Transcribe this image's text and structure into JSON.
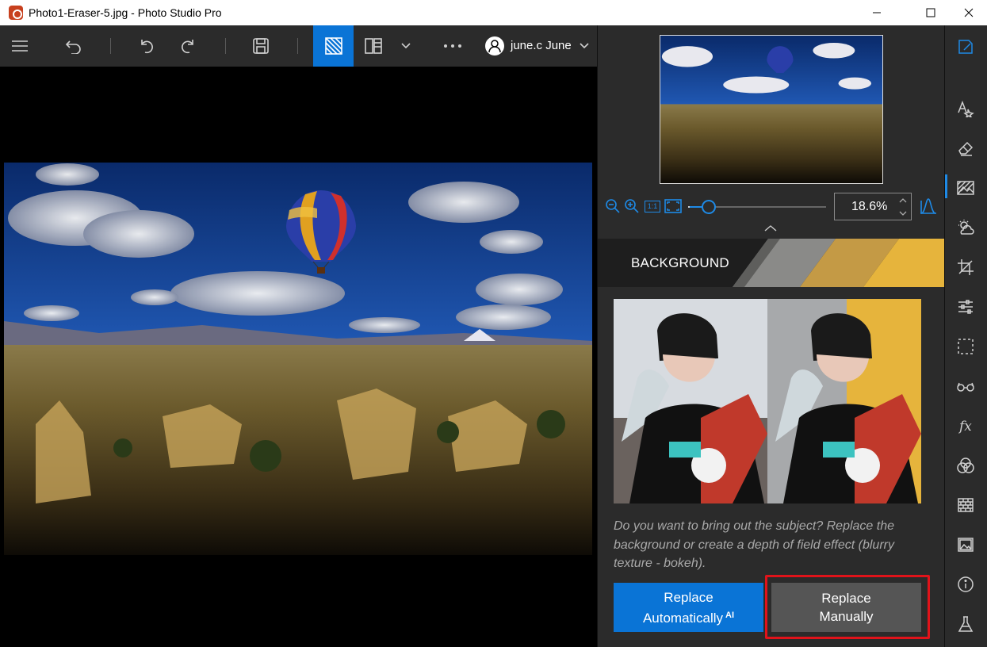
{
  "window": {
    "title": "Photo1-Eraser-5.jpg - Photo Studio Pro",
    "icons": {
      "minimize": "minimize-icon",
      "maximize": "maximize-icon",
      "close": "close-icon"
    }
  },
  "toolbar": {
    "icons": [
      "menu-icon",
      "undo-icon",
      "undo-step-icon",
      "redo-icon",
      "save-icon",
      "view-single-icon",
      "view-compare-icon",
      "chevron-down-icon",
      "more-icon"
    ],
    "user_name": "june.c June",
    "active_view": "view-single"
  },
  "navigator": {
    "zoom_value": "18.6%",
    "zoom_slider_level": 0.14,
    "fit_actual_label": "1:1"
  },
  "background_panel": {
    "title": "BACKGROUND",
    "description": "Do you want to bring out the subject? Replace the background or create a depth of field effect (blurry texture - bokeh).",
    "replace_auto_line1": "Replace",
    "replace_auto_line2": "Automatically",
    "ai_badge": "AI",
    "replace_manual_line1": "Replace",
    "replace_manual_line2": "Manually"
  },
  "sidebar_tools": [
    "edit-icon",
    "text-effects-icon",
    "eraser-icon",
    "background-icon",
    "weather-icon",
    "crop-icon",
    "adjust-icon",
    "selection-icon",
    "glasses-icon",
    "fx-icon",
    "blend-icon",
    "texture-icon",
    "image-icon",
    "info-icon",
    "lab-icon"
  ],
  "colors": {
    "accent": "#0a74d6",
    "panel": "#2b2b2b",
    "highlight": "#e0131a"
  }
}
